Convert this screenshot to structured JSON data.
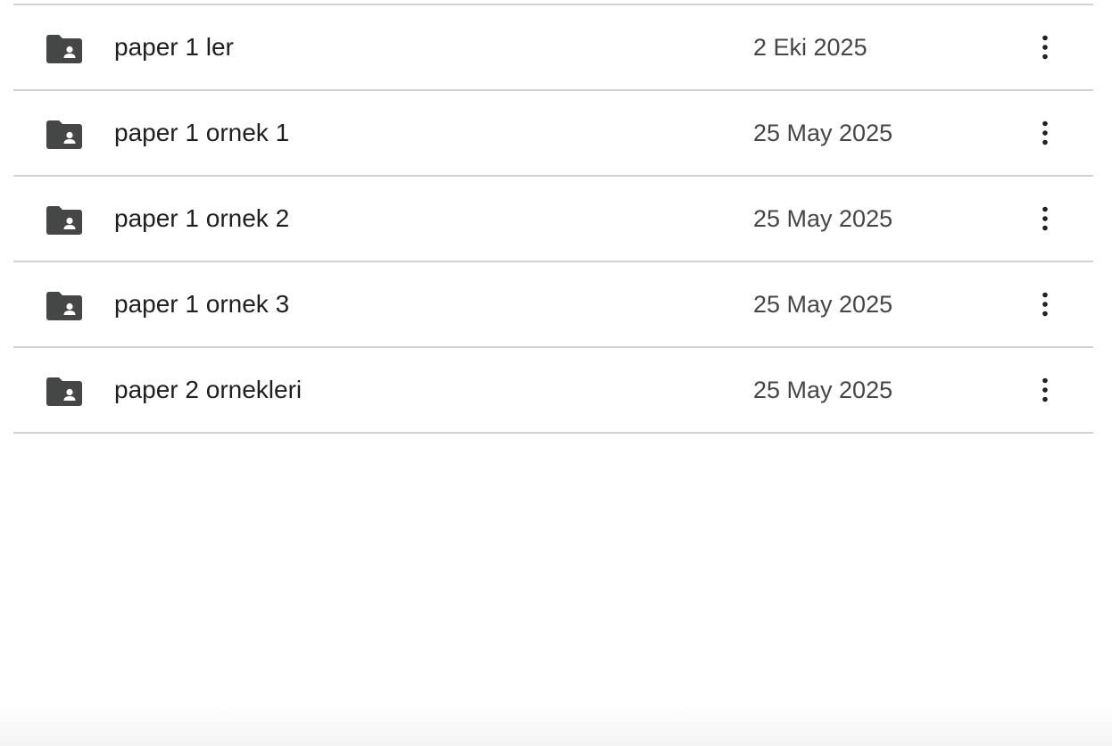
{
  "files": [
    {
      "name": "paper 1 ler",
      "date": "2 Eki 2025",
      "icon": "shared-folder-icon",
      "menu_icon": "more-vert-icon"
    },
    {
      "name": "paper 1 ornek 1",
      "date": "25 May 2025",
      "icon": "shared-folder-icon",
      "menu_icon": "more-vert-icon"
    },
    {
      "name": "paper 1 ornek 2",
      "date": "25 May 2025",
      "icon": "shared-folder-icon",
      "menu_icon": "more-vert-icon"
    },
    {
      "name": "paper 1 ornek 3",
      "date": "25 May 2025",
      "icon": "shared-folder-icon",
      "menu_icon": "more-vert-icon"
    },
    {
      "name": "paper 2 ornekleri",
      "date": "25 May 2025",
      "icon": "shared-folder-icon",
      "menu_icon": "more-vert-icon"
    }
  ],
  "colors": {
    "icon": "#444746",
    "text": "#1f1f1f",
    "secondary_text": "#444746",
    "divider": "#d3d3d3"
  }
}
